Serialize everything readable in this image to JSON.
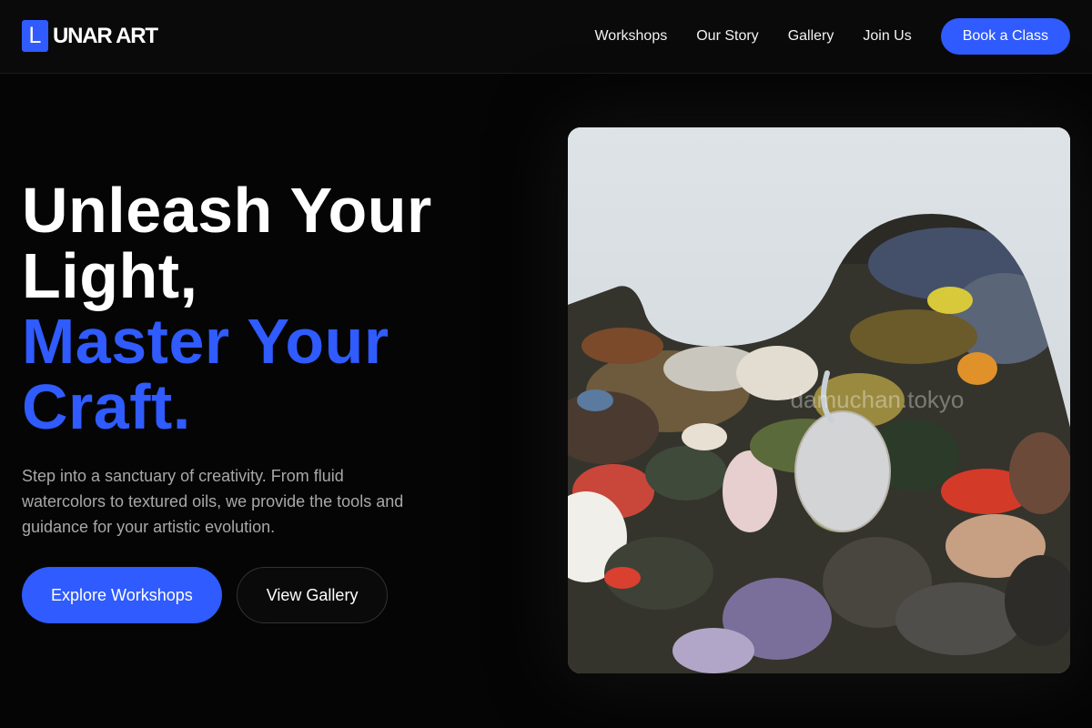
{
  "brand": {
    "mark": "L",
    "name": "UNAR ART",
    "accent": "#2f5bff"
  },
  "nav": {
    "links": [
      "Workshops",
      "Our Story",
      "Gallery",
      "Join Us"
    ],
    "cta": "Book a Class"
  },
  "hero": {
    "headline_white_1": "Unleash Your",
    "headline_white_2": "Light,",
    "headline_blue_1": "Master Your",
    "headline_blue_2": "Craft.",
    "subtext": "Step into a sanctuary of creativity. From fluid watercolors to textured oils, we provide the tools and guidance for your artistic evolution.",
    "primary_button": "Explore Workshops",
    "secondary_button": "View Gallery"
  },
  "image": {
    "alt": "paint palette",
    "watermark": "damuchan.tokyo"
  }
}
